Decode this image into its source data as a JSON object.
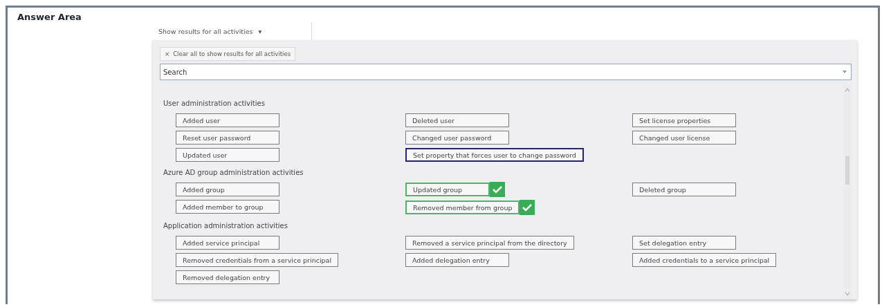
{
  "title": "Answer Area",
  "filter": {
    "label": "Show results for all activities",
    "caret": "▾"
  },
  "clear_chip": {
    "icon": "×",
    "label": "Clear all to show results for all activities"
  },
  "search": {
    "value": "Search"
  },
  "sections": [
    {
      "heading": "User administration activities",
      "columns": [
        [
          {
            "label": "Added user",
            "selected": false,
            "checked": false
          },
          {
            "label": "Reset user password",
            "selected": false,
            "checked": false
          },
          {
            "label": "Updated user",
            "selected": false,
            "checked": false
          }
        ],
        [
          {
            "label": "Deleted user",
            "selected": false,
            "checked": false
          },
          {
            "label": "Changed user password",
            "selected": false,
            "checked": false
          },
          {
            "label": "Set property that forces user to change password",
            "selected": true,
            "checked": false
          }
        ],
        [
          {
            "label": "Set license properties",
            "selected": false,
            "checked": false
          },
          {
            "label": "Changed user license",
            "selected": false,
            "checked": false
          }
        ]
      ]
    },
    {
      "heading": "Azure AD group administration activities",
      "columns": [
        [
          {
            "label": "Added group",
            "selected": false,
            "checked": false
          },
          {
            "label": "Added member to group",
            "selected": false,
            "checked": false
          }
        ],
        [
          {
            "label": "Updated group",
            "selected": false,
            "checked": true
          },
          {
            "label": "Removed member from group",
            "selected": false,
            "checked": true
          }
        ],
        [
          {
            "label": "Deleted group",
            "selected": false,
            "checked": false
          }
        ]
      ]
    },
    {
      "heading": "Application administration activities",
      "columns": [
        [
          {
            "label": "Added service principal",
            "selected": false,
            "checked": false
          },
          {
            "label": "Removed credentials from a service principal",
            "selected": false,
            "checked": false
          },
          {
            "label": "Removed delegation entry",
            "selected": false,
            "checked": false
          }
        ],
        [
          {
            "label": "Removed a service principal from the directory",
            "selected": false,
            "checked": false
          },
          {
            "label": "Added delegation entry",
            "selected": false,
            "checked": false
          }
        ],
        [
          {
            "label": "Set delegation entry",
            "selected": false,
            "checked": false
          },
          {
            "label": "Added credentials to a service principal",
            "selected": false,
            "checked": false
          }
        ]
      ]
    }
  ]
}
